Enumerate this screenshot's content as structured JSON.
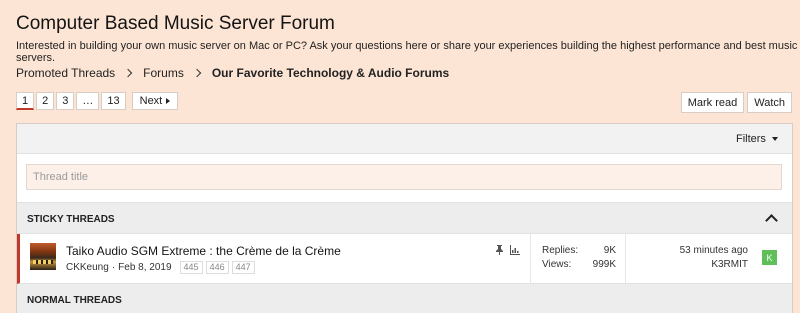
{
  "forum": {
    "title": "Computer Based Music Server Forum",
    "description": "Interested in building your own music server on Mac or PC? Ask your questions here or share your experiences building the highest performance and best music servers."
  },
  "breadcrumb": [
    "Promoted Threads",
    "Forums",
    "Our Favorite Technology & Audio Forums"
  ],
  "pagination": {
    "pages": [
      "1",
      "2",
      "3",
      "…",
      "13"
    ],
    "current": "1",
    "next_label": "Next"
  },
  "actions": {
    "mark_read": "Mark read",
    "watch": "Watch"
  },
  "filters_label": "Filters",
  "search": {
    "placeholder": "Thread title"
  },
  "sections": {
    "sticky": "STICKY THREADS",
    "normal": "NORMAL THREADS"
  },
  "thread": {
    "title": "Taiko Audio SGM Extreme : the Crème de la Crème",
    "author": "CKKeung",
    "date": "Feb 8, 2019",
    "page_links": [
      "445",
      "446",
      "447"
    ],
    "replies_label": "Replies:",
    "replies": "9K",
    "views_label": "Views:",
    "views": "999K",
    "last_post_time": "53 minutes ago",
    "last_poster": "K3RMIT",
    "avatar_letter": "K"
  },
  "colors": {
    "accent": "#c0392b",
    "avatar": "#5fbf58",
    "background": "#fde5d5"
  }
}
